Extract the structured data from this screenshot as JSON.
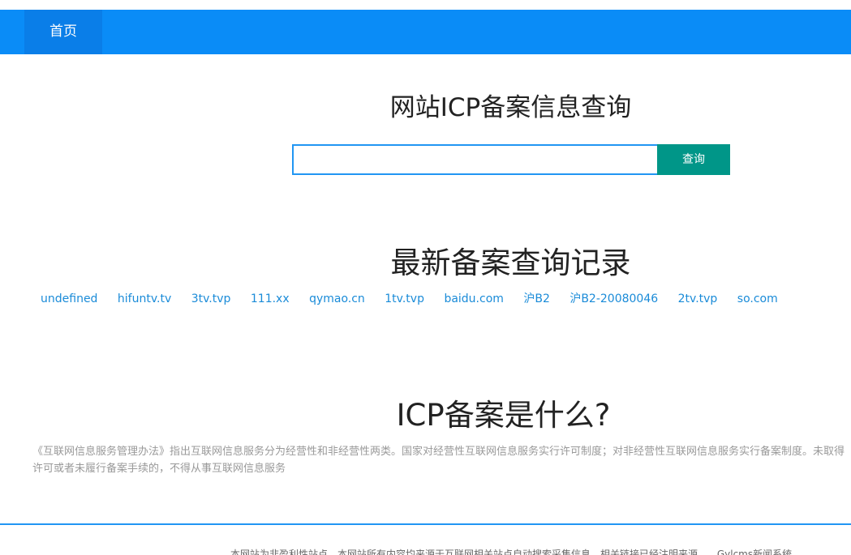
{
  "nav": {
    "home_label": "首页"
  },
  "search": {
    "title": "网站ICP备案信息查询",
    "input_value": "",
    "button_label": "查询"
  },
  "recent": {
    "title": "最新备案查询记录",
    "links": [
      "undefined",
      "hifuntv.tv",
      "3tv.tvp",
      "111.xx",
      "qymao.cn",
      "1tv.tvp",
      "baidu.com",
      "沪B2",
      "沪B2-20080046",
      "2tv.tvp",
      "so.com"
    ]
  },
  "what": {
    "title": "ICP备案是什么?",
    "text": "《互联网信息服务管理办法》指出互联网信息服务分为经营性和非经营性两类。国家对经营性互联网信息服务实行许可制度；对非经营性互联网信息服务实行备案制度。未取得许可或者未履行备案手续的，不得从事互联网信息服务"
  },
  "footer": {
    "text": "本网站为非盈利性站点，本网站所有内容均来源于互联网相关站点自动搜索采集信息，相关链接已经注明来源。",
    "system_link": "Gylcms新闻系统"
  },
  "colors": {
    "nav_bar": "#0a8cf7",
    "nav_active": "#0a7ee8",
    "search_button": "#009688",
    "link": "#1a8bd8",
    "input_border": "#2196f3"
  }
}
